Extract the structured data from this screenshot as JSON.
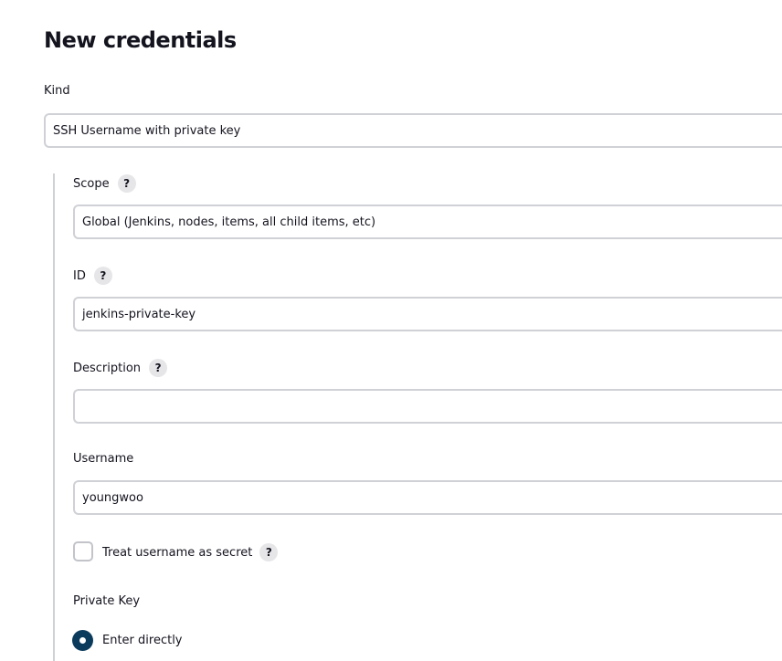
{
  "page": {
    "title": "New credentials"
  },
  "kind": {
    "label": "Kind",
    "value": "SSH Username with private key"
  },
  "scope": {
    "label": "Scope",
    "help": "?",
    "value": "Global (Jenkins, nodes, items, all child items, etc)"
  },
  "id_field": {
    "label": "ID",
    "help": "?",
    "value": "jenkins-private-key"
  },
  "description": {
    "label": "Description",
    "help": "?",
    "value": ""
  },
  "username": {
    "label": "Username",
    "value": "youngwoo"
  },
  "treat_secret": {
    "label": "Treat username as secret",
    "help": "?",
    "checked": false
  },
  "private_key": {
    "label": "Private Key",
    "options": [
      {
        "label": "Enter directly",
        "selected": true
      }
    ]
  },
  "colors": {
    "radio_selected": "#0b3b5c",
    "field_border": "#cfd1d6",
    "help_bg": "#e6e6e9"
  }
}
